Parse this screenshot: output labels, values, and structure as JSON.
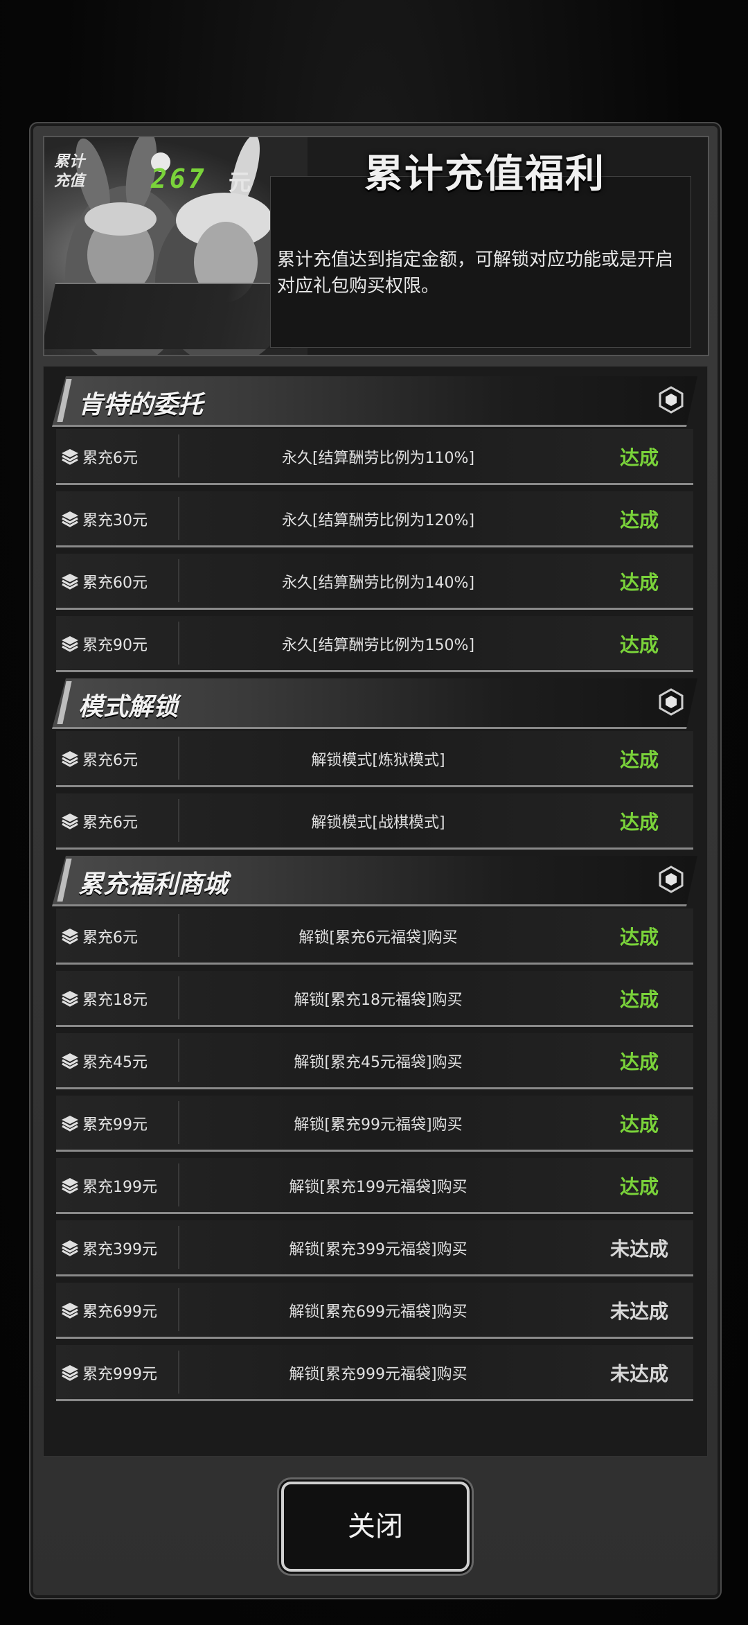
{
  "header": {
    "title": "累计充值福利",
    "description": "累计充值达到指定金额，可解锁对应功能或是开启对应礼包购买权限。",
    "total_label_line1": "累计",
    "total_label_line2": "充值",
    "total_value": "267",
    "total_unit": "元"
  },
  "sections": [
    {
      "name": "肯特的委托",
      "rows": [
        {
          "req": "累充6元",
          "reward": "永久[结算酬劳比例为110%]",
          "status": "达成",
          "done": true
        },
        {
          "req": "累充30元",
          "reward": "永久[结算酬劳比例为120%]",
          "status": "达成",
          "done": true
        },
        {
          "req": "累充60元",
          "reward": "永久[结算酬劳比例为140%]",
          "status": "达成",
          "done": true
        },
        {
          "req": "累充90元",
          "reward": "永久[结算酬劳比例为150%]",
          "status": "达成",
          "done": true
        }
      ]
    },
    {
      "name": "模式解锁",
      "rows": [
        {
          "req": "累充6元",
          "reward": "解锁模式[炼狱模式]",
          "status": "达成",
          "done": true
        },
        {
          "req": "累充6元",
          "reward": "解锁模式[战棋模式]",
          "status": "达成",
          "done": true
        }
      ]
    },
    {
      "name": "累充福利商城",
      "rows": [
        {
          "req": "累充6元",
          "reward": "解锁[累充6元福袋]购买",
          "status": "达成",
          "done": true
        },
        {
          "req": "累充18元",
          "reward": "解锁[累充18元福袋]购买",
          "status": "达成",
          "done": true
        },
        {
          "req": "累充45元",
          "reward": "解锁[累充45元福袋]购买",
          "status": "达成",
          "done": true
        },
        {
          "req": "累充99元",
          "reward": "解锁[累充99元福袋]购买",
          "status": "达成",
          "done": true
        },
        {
          "req": "累充199元",
          "reward": "解锁[累充199元福袋]购买",
          "status": "达成",
          "done": true
        },
        {
          "req": "累充399元",
          "reward": "解锁[累充399元福袋]购买",
          "status": "未达成",
          "done": false
        },
        {
          "req": "累充699元",
          "reward": "解锁[累充699元福袋]购买",
          "status": "未达成",
          "done": false
        },
        {
          "req": "累充999元",
          "reward": "解锁[累充999元福袋]购买",
          "status": "未达成",
          "done": false
        }
      ]
    }
  ],
  "colors": {
    "done": "#7ad33a",
    "not_done": "#d8d8d8",
    "accent_total": "#7ad33a"
  },
  "icons": {
    "row_icon": "stack-layers-icon",
    "section_icon": "hexagon-icon"
  },
  "close_button": "关闭"
}
